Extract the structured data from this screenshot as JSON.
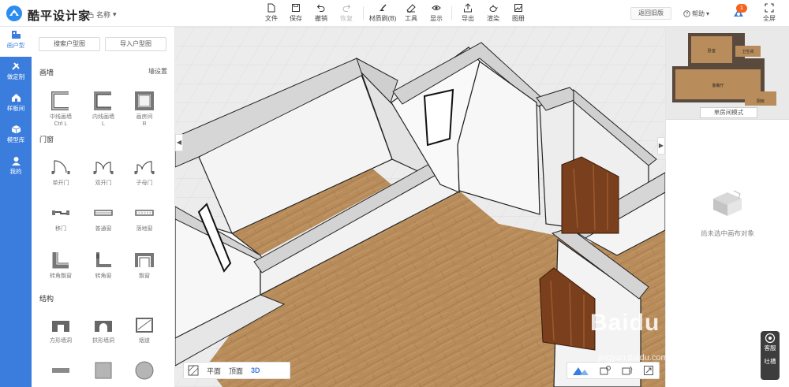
{
  "app": {
    "brand": "酷平设计家",
    "doc_name": "名称"
  },
  "toolbar": {
    "file": "文件",
    "save": "保存",
    "undo": "撤销",
    "redo": "恢复",
    "material": "材质刷(B)",
    "tools": "工具",
    "display": "显示",
    "export": "导出",
    "render": "渲染",
    "drawings": "图册"
  },
  "header_right": {
    "old_version": "返回旧版",
    "help": "帮助",
    "notifications": "1",
    "fullscreen": "全屏"
  },
  "nav": [
    {
      "label": "画户型",
      "icon": "floorplan-icon"
    },
    {
      "label": "做定制",
      "icon": "tools-icon"
    },
    {
      "label": "样板间",
      "icon": "house-icon"
    },
    {
      "label": "模型库",
      "icon": "cube-icon"
    },
    {
      "label": "我的",
      "icon": "user-icon"
    }
  ],
  "panel": {
    "search_plan": "搜索户型图",
    "import_plan": "导入户型图",
    "wall_section": "画墙",
    "wall_settings": "墙设置",
    "walls": [
      {
        "label": "中线画墙",
        "hint": "Ctrl L"
      },
      {
        "label": "内线画墙",
        "hint": "L"
      },
      {
        "label": "画房间",
        "hint": "R"
      }
    ],
    "door_section": "门窗",
    "doors": [
      {
        "label": "单开门"
      },
      {
        "label": "双开门"
      },
      {
        "label": "子母门"
      },
      {
        "label": "移门"
      },
      {
        "label": "普通窗"
      },
      {
        "label": "落地窗"
      },
      {
        "label": "转角飘窗"
      },
      {
        "label": "转角窗"
      },
      {
        "label": "飘窗"
      }
    ],
    "struct_section": "结构",
    "structs": [
      {
        "label": "方形墙洞"
      },
      {
        "label": "拱形墙洞"
      },
      {
        "label": "烟道"
      },
      {
        "label": ""
      },
      {
        "label": ""
      },
      {
        "label": ""
      }
    ]
  },
  "view_modes": {
    "plan": "平面",
    "top": "顶面",
    "three_d": "3D"
  },
  "right_panel": {
    "minimap_rooms": [
      "卧室",
      "卫生间",
      "客餐厅",
      "厨房"
    ],
    "mode_button": "单房间模式",
    "empty_text": "尚未选中画布对象"
  },
  "watermark": {
    "main": "Baidu 经验",
    "sub": "jingyan.baidu.com"
  },
  "support": {
    "service": "客服",
    "feedback": "吐槽"
  },
  "colors": {
    "accent": "#3b7ddd",
    "badge": "#f5641e",
    "floor": "#b78c5d",
    "door": "#7a3f1c"
  }
}
